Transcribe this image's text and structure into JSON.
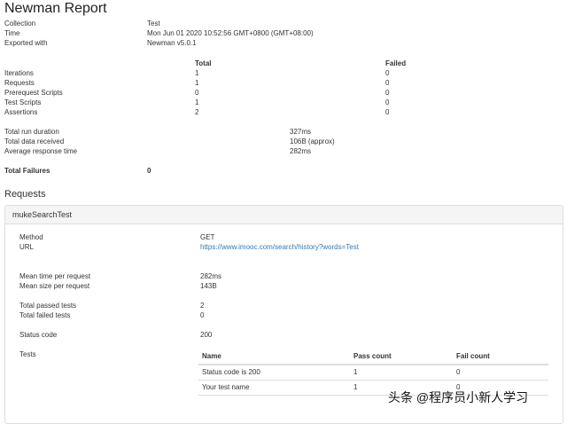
{
  "report": {
    "title": "Newman Report",
    "collection_label": "Collection",
    "collection_value": "Test",
    "time_label": "Time",
    "time_value": "Mon Jun 01 2020 10:52:56 GMT+0800 (GMT+08:00)",
    "exported_label": "Exported with",
    "exported_value": "Newman v5.0.1"
  },
  "summary": {
    "headers": {
      "total": "Total",
      "failed": "Failed"
    },
    "rows": [
      {
        "label": "Iterations",
        "total": "1",
        "failed": "0"
      },
      {
        "label": "Requests",
        "total": "1",
        "failed": "0"
      },
      {
        "label": "Prerequest Scripts",
        "total": "0",
        "failed": "0"
      },
      {
        "label": "Test Scripts",
        "total": "1",
        "failed": "0"
      },
      {
        "label": "Assertions",
        "total": "2",
        "failed": "0"
      }
    ],
    "stats": [
      {
        "label": "Total run duration",
        "value": "327ms"
      },
      {
        "label": "Total data received",
        "value": "106B (approx)"
      },
      {
        "label": "Average response time",
        "value": "282ms"
      }
    ],
    "failures_label": "Total Failures",
    "failures_value": "0"
  },
  "requests": {
    "heading": "Requests",
    "panel_title": "mukeSearchTest",
    "method_label": "Method",
    "method_value": "GET",
    "url_label": "URL",
    "url_value": "https://www.imooc.com/search/history?words=Test",
    "mean_time_label": "Mean time per request",
    "mean_time_value": "282ms",
    "mean_size_label": "Mean size per request",
    "mean_size_value": "143B",
    "passed_label": "Total passed tests",
    "passed_value": "2",
    "failed_label": "Total failed tests",
    "failed_value": "0",
    "status_label": "Status code",
    "status_value": "200",
    "tests_label": "Tests",
    "tests_headers": {
      "name": "Name",
      "pass": "Pass count",
      "fail": "Fail count"
    },
    "tests_rows": [
      {
        "name": "Status code is 200",
        "pass": "1",
        "fail": "0"
      },
      {
        "name": "Your test name",
        "pass": "1",
        "fail": "0"
      }
    ]
  },
  "watermark": "头条 @程序员小新人学习"
}
